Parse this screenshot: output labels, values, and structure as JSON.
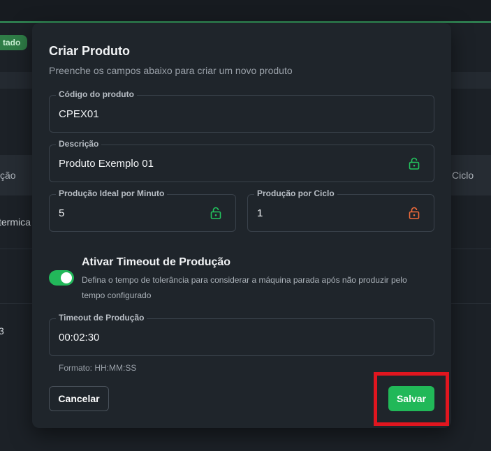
{
  "background": {
    "badge": "tado",
    "col_left": "ção",
    "col_right": "Ciclo",
    "row1_text": "termica",
    "row3_text": "3"
  },
  "modal": {
    "title": "Criar Produto",
    "subtitle": "Preenche os campos abaixo para criar um novo produto",
    "fields": {
      "code": {
        "label": "Código do produto",
        "value": "CPEX01"
      },
      "description": {
        "label": "Descrição",
        "value": "Produto Exemplo 01",
        "lock": "unlocked",
        "lock_color": "#22c55e"
      },
      "ideal_per_minute": {
        "label": "Produção Ideal por Minuto",
        "value": "5",
        "lock": "unlocked",
        "lock_color": "#22c55e"
      },
      "per_cycle": {
        "label": "Produção por Ciclo",
        "value": "1",
        "lock": "unlocked",
        "lock_color": "#f26b3a"
      },
      "timeout": {
        "label": "Timeout de Produção",
        "value": "00:02:30",
        "helper": "Formato: HH:MM:SS"
      }
    },
    "timeout_toggle": {
      "on": true,
      "title": "Ativar Timeout de Produção",
      "description": "Defina o tempo de tolerância para considerar a máquina parada após não produzir pelo tempo configurado"
    },
    "buttons": {
      "cancel": "Cancelar",
      "save": "Salvar"
    }
  },
  "colors": {
    "accent": "#21b858",
    "highlight": "#e0161f"
  }
}
